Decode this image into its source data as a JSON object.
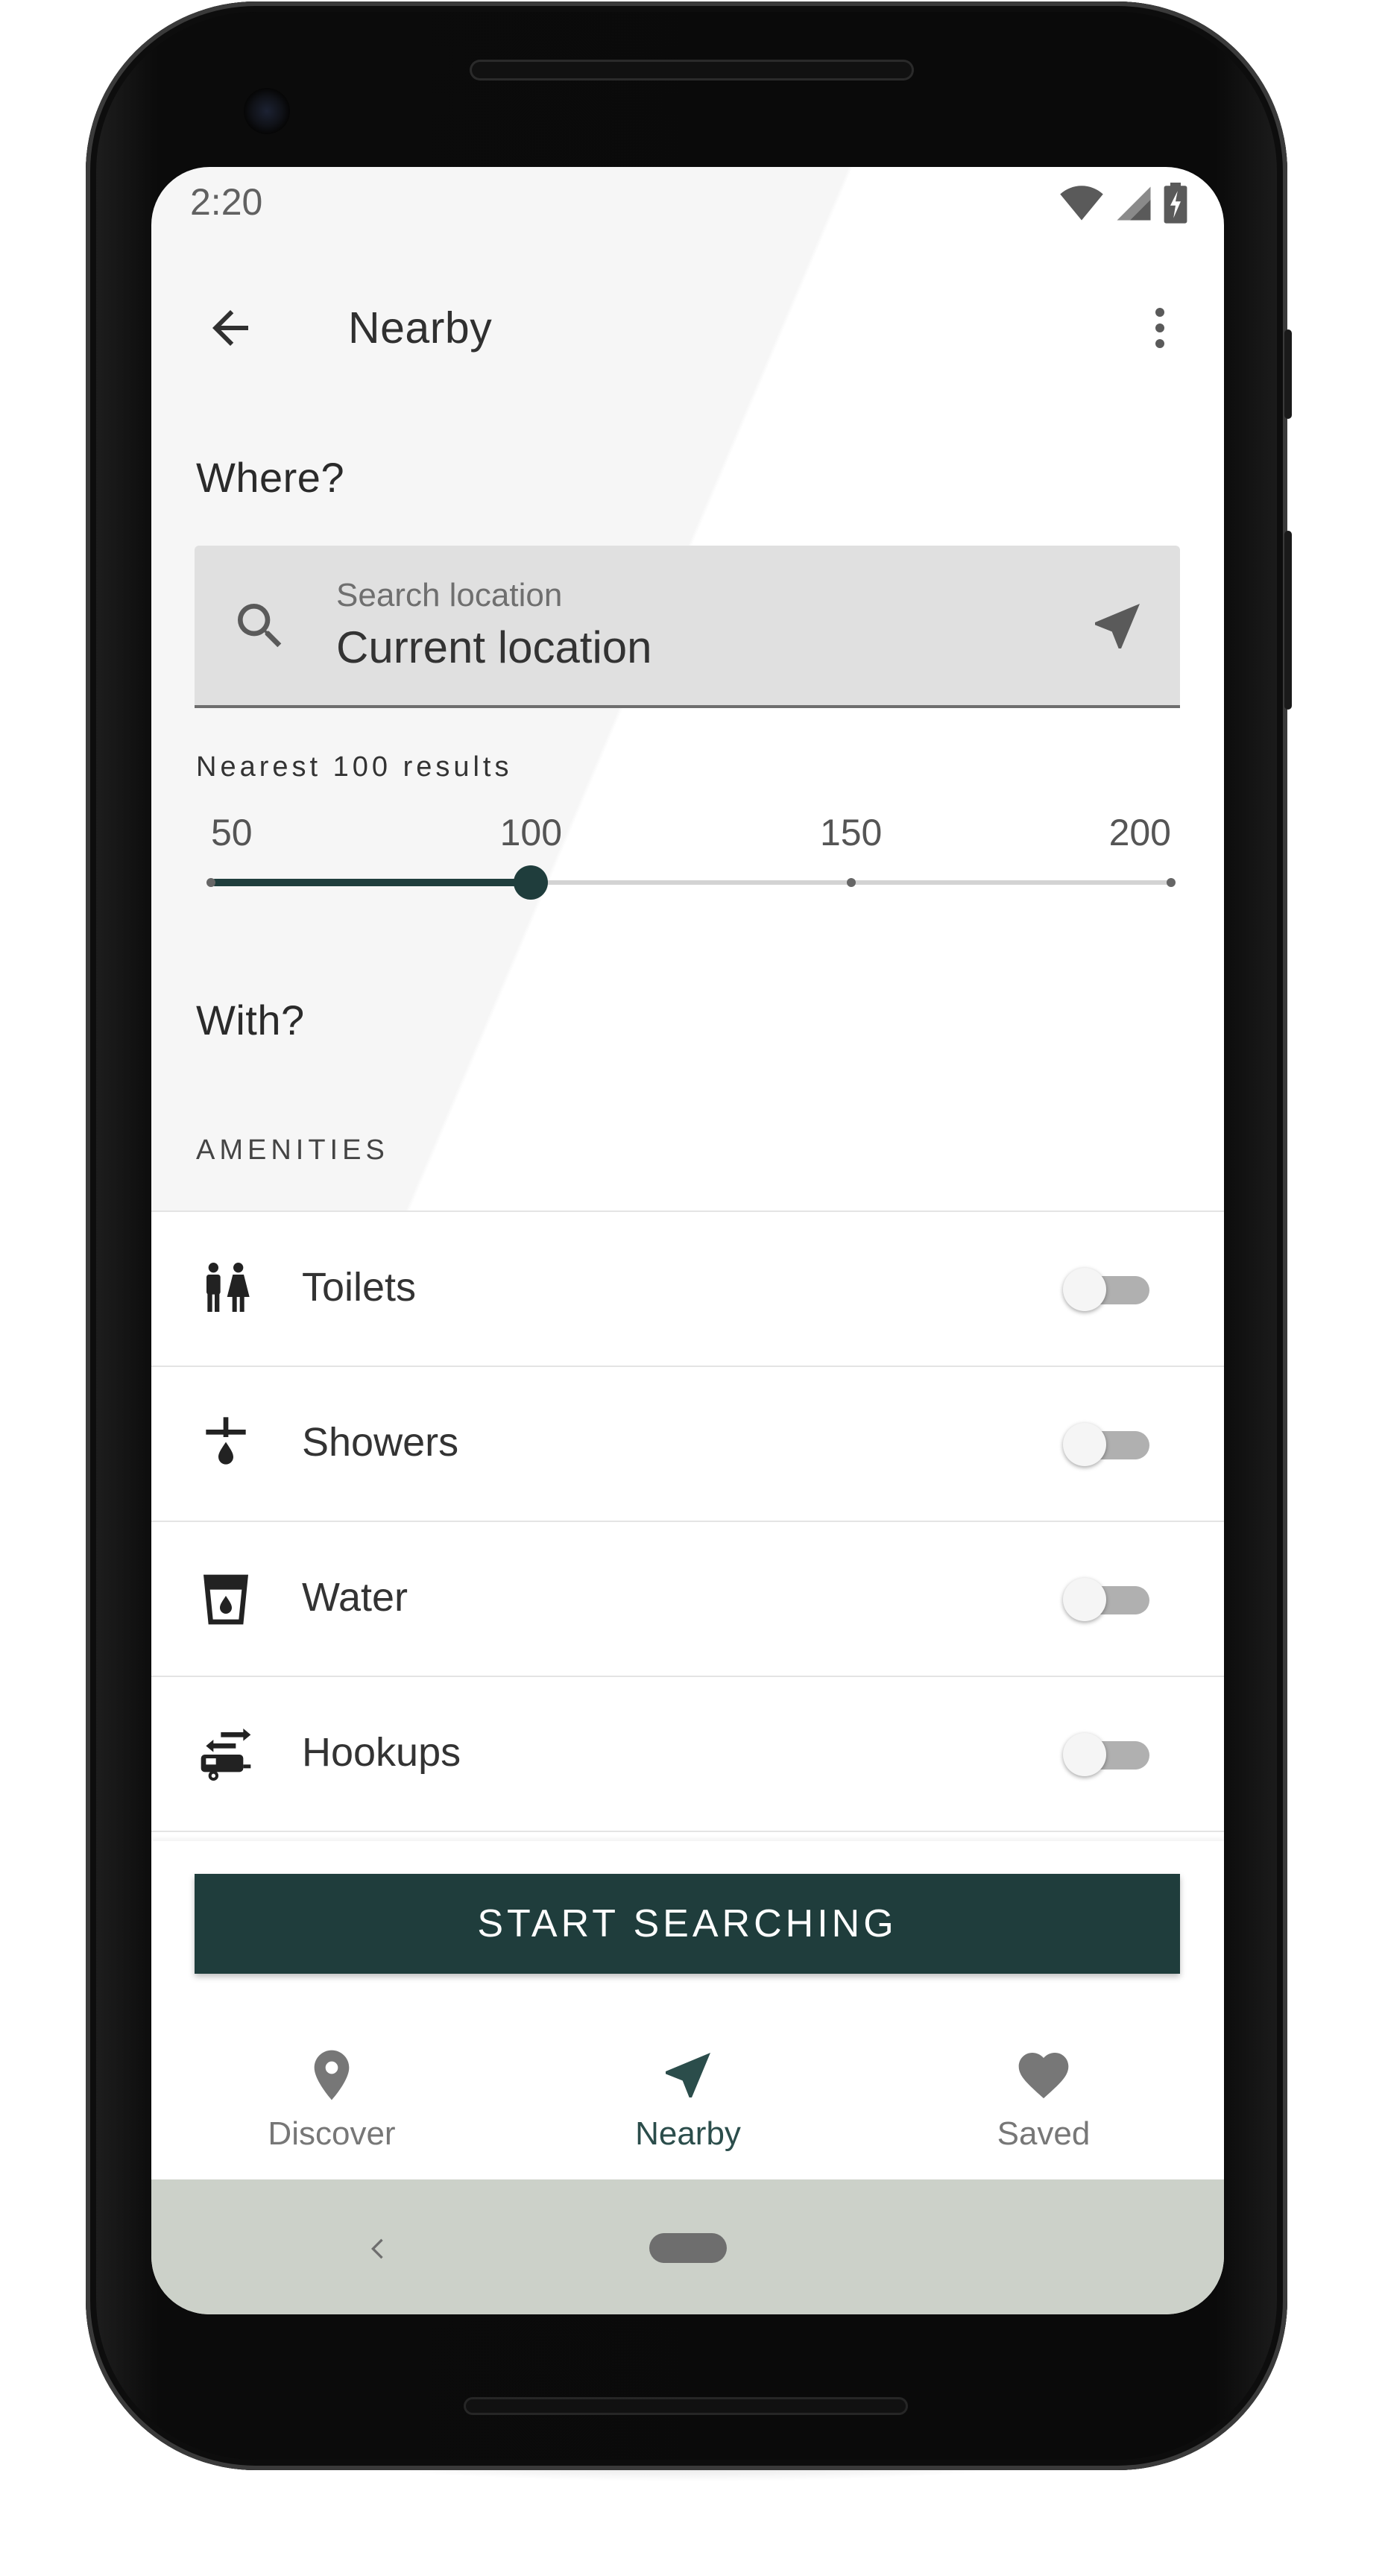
{
  "status_bar": {
    "time": "2:20"
  },
  "app_bar": {
    "title": "Nearby"
  },
  "where": {
    "heading": "Where?",
    "search": {
      "placeholder": "Search location",
      "value": "Current location"
    }
  },
  "results": {
    "label": "Nearest 100 results",
    "ticks": [
      "50",
      "100",
      "150",
      "200"
    ],
    "min": 50,
    "max": 200,
    "step": 50,
    "value": 100
  },
  "with": {
    "heading": "With?",
    "subheader": "AMENITIES",
    "amenities": [
      {
        "label": "Toilets",
        "icon": "toilets-icon",
        "enabled": false
      },
      {
        "label": "Showers",
        "icon": "shower-icon",
        "enabled": false
      },
      {
        "label": "Water",
        "icon": "water-icon",
        "enabled": false
      },
      {
        "label": "Hookups",
        "icon": "hookups-icon",
        "enabled": false
      }
    ]
  },
  "cta": {
    "label": "START SEARCHING"
  },
  "bottom_nav": [
    {
      "label": "Discover",
      "icon": "place-pin-icon",
      "active": false
    },
    {
      "label": "Nearby",
      "icon": "navigation-arrow-icon",
      "active": true
    },
    {
      "label": "Saved",
      "icon": "heart-icon",
      "active": false
    }
  ],
  "colors": {
    "primary": "#1f3d3c",
    "nav_active": "#2b4d4b",
    "nav_inactive": "#777777",
    "system_nav": "#ccd1c9"
  }
}
